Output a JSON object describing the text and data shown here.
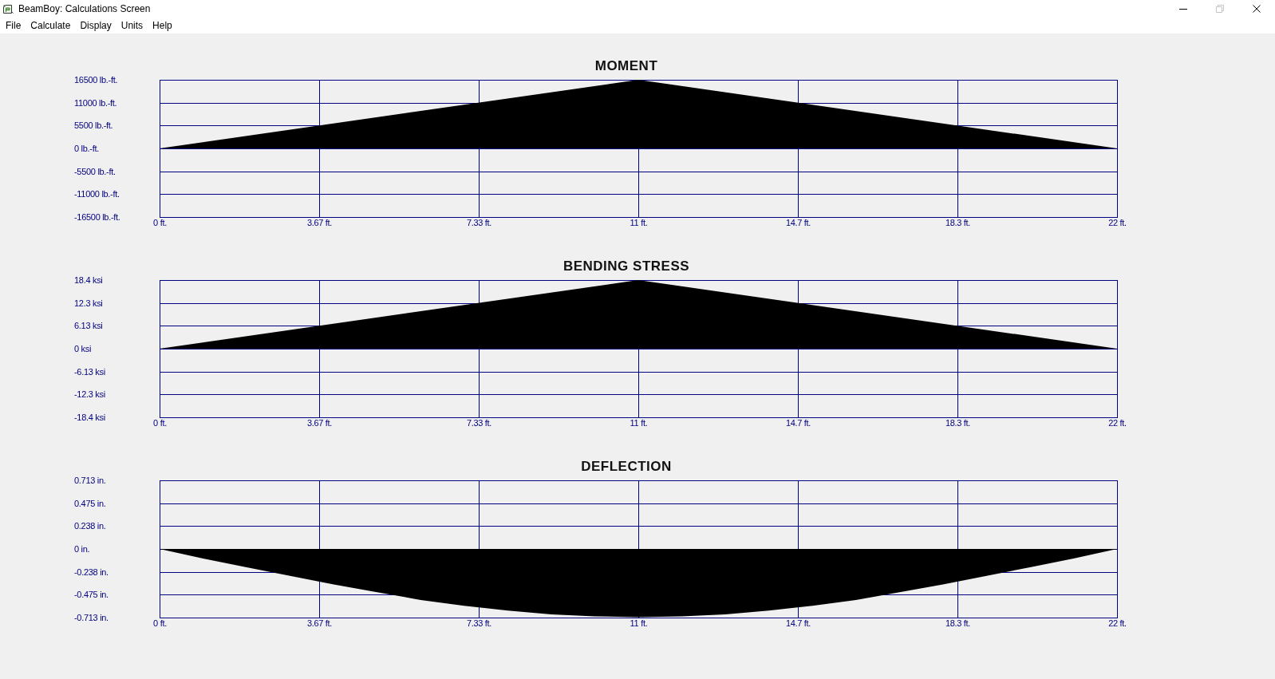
{
  "window": {
    "title": "BeamBoy: Calculations Screen",
    "controls": [
      {
        "kind": "minimize",
        "disabled": false
      },
      {
        "kind": "restore",
        "disabled": true
      },
      {
        "kind": "close",
        "disabled": false
      }
    ]
  },
  "menu": [
    "File",
    "Calculate",
    "Display",
    "Units",
    "Help"
  ],
  "charts": [
    {
      "chart_data": {
        "type": "area",
        "title": "MOMENT",
        "grid": true,
        "x": [
          0,
          11,
          22
        ],
        "values": [
          0,
          16500,
          0
        ],
        "xlim": [
          0,
          22
        ],
        "ylim": [
          -16500,
          16500
        ],
        "xticks": [
          {
            "value": 0,
            "label": "0 ft."
          },
          {
            "value": 3.667,
            "label": "3.67 ft."
          },
          {
            "value": 7.333,
            "label": "7.33 ft."
          },
          {
            "value": 11,
            "label": "11 ft."
          },
          {
            "value": 14.667,
            "label": "14.7 ft."
          },
          {
            "value": 18.333,
            "label": "18.3 ft."
          },
          {
            "value": 22,
            "label": "22 ft."
          }
        ],
        "yticks": [
          {
            "value": 16500,
            "label": "16500 lb.-ft."
          },
          {
            "value": 11000,
            "label": "11000 lb.-ft."
          },
          {
            "value": 5500,
            "label": "5500 lb.-ft."
          },
          {
            "value": 0,
            "label": "0 lb.-ft."
          },
          {
            "value": -5500,
            "label": "-5500 lb.-ft."
          },
          {
            "value": -11000,
            "label": "-11000 lb.-ft."
          },
          {
            "value": -16500,
            "label": "-16500 lb.-ft."
          }
        ]
      }
    },
    {
      "chart_data": {
        "type": "area",
        "title": "BENDING STRESS",
        "grid": true,
        "x": [
          0,
          11,
          22
        ],
        "values": [
          0,
          18.4,
          0
        ],
        "xlim": [
          0,
          22
        ],
        "ylim": [
          -18.4,
          18.4
        ],
        "xticks": [
          {
            "value": 0,
            "label": "0 ft."
          },
          {
            "value": 3.667,
            "label": "3.67 ft."
          },
          {
            "value": 7.333,
            "label": "7.33 ft."
          },
          {
            "value": 11,
            "label": "11 ft."
          },
          {
            "value": 14.667,
            "label": "14.7 ft."
          },
          {
            "value": 18.333,
            "label": "18.3 ft."
          },
          {
            "value": 22,
            "label": "22 ft."
          }
        ],
        "yticks": [
          {
            "value": 18.4,
            "label": "18.4 ksi"
          },
          {
            "value": 12.27,
            "label": "12.3 ksi"
          },
          {
            "value": 6.13,
            "label": "6.13 ksi"
          },
          {
            "value": 0,
            "label": "0 ksi"
          },
          {
            "value": -6.13,
            "label": "-6.13 ksi"
          },
          {
            "value": -12.27,
            "label": "-12.3 ksi"
          },
          {
            "value": -18.4,
            "label": "-18.4 ksi"
          }
        ]
      }
    },
    {
      "chart_data": {
        "type": "area",
        "title": "DEFLECTION",
        "grid": true,
        "x": [
          0,
          1,
          2,
          3,
          4,
          5,
          6,
          7,
          8,
          9,
          10,
          11,
          12,
          13,
          14,
          15,
          16,
          17,
          18,
          19,
          20,
          21,
          22
        ],
        "values": [
          0,
          -0.1,
          -0.19,
          -0.28,
          -0.37,
          -0.45,
          -0.53,
          -0.59,
          -0.64,
          -0.68,
          -0.7,
          -0.71,
          -0.7,
          -0.68,
          -0.64,
          -0.59,
          -0.53,
          -0.45,
          -0.37,
          -0.28,
          -0.19,
          -0.1,
          0
        ],
        "xlim": [
          0,
          22
        ],
        "ylim": [
          -0.713,
          0.713
        ],
        "xticks": [
          {
            "value": 0,
            "label": "0 ft."
          },
          {
            "value": 3.667,
            "label": "3.67 ft."
          },
          {
            "value": 7.333,
            "label": "7.33 ft."
          },
          {
            "value": 11,
            "label": "11 ft."
          },
          {
            "value": 14.667,
            "label": "14.7 ft."
          },
          {
            "value": 18.333,
            "label": "18.3 ft."
          },
          {
            "value": 22,
            "label": "22 ft."
          }
        ],
        "yticks": [
          {
            "value": 0.713,
            "label": "0.713 in."
          },
          {
            "value": 0.475,
            "label": "0.475 in."
          },
          {
            "value": 0.238,
            "label": "0.238 in."
          },
          {
            "value": 0,
            "label": "0 in."
          },
          {
            "value": -0.238,
            "label": "-0.238 in."
          },
          {
            "value": -0.475,
            "label": "-0.475 in."
          },
          {
            "value": -0.713,
            "label": "-0.713 in."
          }
        ]
      }
    }
  ]
}
